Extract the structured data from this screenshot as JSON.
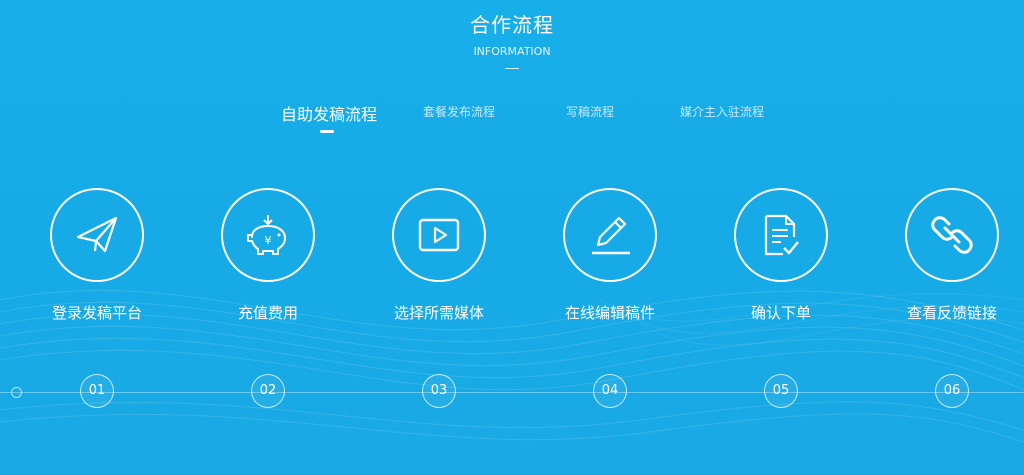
{
  "section": {
    "title": "合作流程",
    "subtitle": "INFORMATION"
  },
  "tabs": [
    {
      "label": "自助发稿流程",
      "active": true
    },
    {
      "label": "套餐发布流程",
      "active": false
    },
    {
      "label": "写稿流程",
      "active": false
    },
    {
      "label": "媒介主入驻流程",
      "active": false
    }
  ],
  "steps": [
    {
      "label": "登录发稿平台",
      "icon": "paper-plane-icon",
      "number": "01"
    },
    {
      "label": "充值费用",
      "icon": "piggy-bank-icon",
      "number": "02"
    },
    {
      "label": "选择所需媒体",
      "icon": "video-play-icon",
      "number": "03"
    },
    {
      "label": "在线编辑稿件",
      "icon": "pencil-icon",
      "number": "04"
    },
    {
      "label": "确认下单",
      "icon": "document-check-icon",
      "number": "05"
    },
    {
      "label": "查看反馈链接",
      "icon": "chain-link-icon",
      "number": "06"
    }
  ],
  "colors": {
    "background": "#17aeea",
    "foreground": "#ffffff"
  }
}
